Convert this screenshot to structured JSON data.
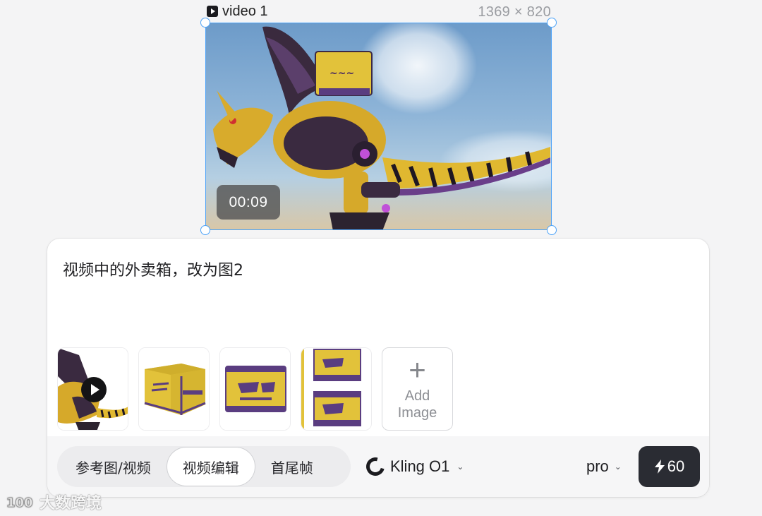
{
  "canvas": {
    "frame_label": "video 1",
    "frame_dimensions": "1369 × 820",
    "timecode": "00:09",
    "selection_color": "#4da3f7"
  },
  "prompt": {
    "text": "视频中的外卖箱，改为图2"
  },
  "attachments": {
    "items": [
      {
        "kind": "video",
        "icon": "play-icon"
      },
      {
        "kind": "image"
      },
      {
        "kind": "image"
      },
      {
        "kind": "image"
      }
    ],
    "add_label": "Add Image"
  },
  "toolbar": {
    "modes": [
      {
        "label": "参考图/视频",
        "active": false
      },
      {
        "label": "视频编辑",
        "active": true
      },
      {
        "label": "首尾帧",
        "active": false
      }
    ],
    "model": "Kling O1",
    "quality": "pro",
    "credits": "60",
    "accent": "#2a2c33"
  },
  "watermark": {
    "text": "大数跨境",
    "logo_text": "100"
  }
}
